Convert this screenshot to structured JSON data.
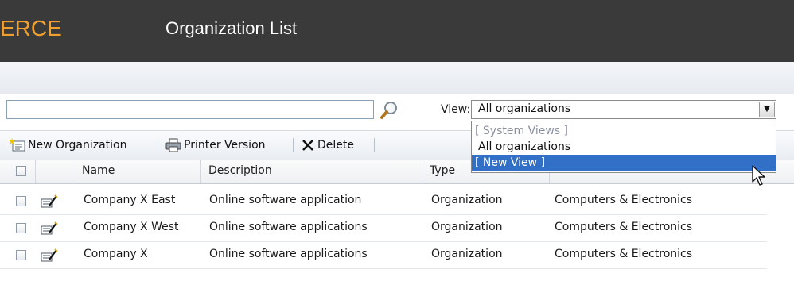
{
  "header": {
    "brand": "ERCE",
    "title": "Organization List"
  },
  "search": {
    "value": "",
    "placeholder": ""
  },
  "view": {
    "label": "View:",
    "selected": "All organizations",
    "options": [
      {
        "label": "[ System Views ]",
        "kind": "group"
      },
      {
        "label": "All organizations",
        "kind": "option"
      },
      {
        "label": "[ New View ]",
        "kind": "highlighted"
      }
    ]
  },
  "toolbar": {
    "new_label": "New Organization",
    "print_label": "Printer Version",
    "delete_label": "Delete"
  },
  "grid": {
    "columns": [
      "Name",
      "Description",
      "Type"
    ],
    "rows": [
      {
        "name": "Company X East",
        "description": "Online software application",
        "type": "Organization",
        "industry": "Computers & Electronics"
      },
      {
        "name": "Company X West",
        "description": "Online software applications",
        "type": "Organization",
        "industry": "Computers & Electronics"
      },
      {
        "name": "Company X",
        "description": "Online software applications",
        "type": "Organization",
        "industry": "Computers & Electronics"
      }
    ]
  },
  "colors": {
    "header_bg": "#3a3a3a",
    "brand": "#f0a030",
    "highlight": "#3170c6"
  }
}
